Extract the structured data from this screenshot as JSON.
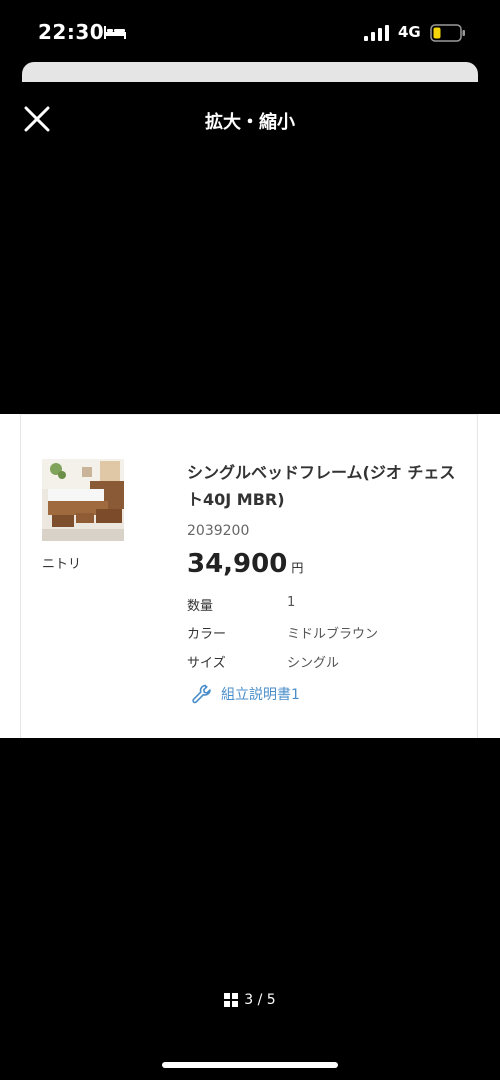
{
  "status_bar": {
    "time": "22:30",
    "network": "4G",
    "battery_color": "#f5d60a"
  },
  "header": {
    "title": "拡大・縮小",
    "close_icon": "close-icon"
  },
  "product": {
    "brand": "ニトリ",
    "name": "シングルベッドフレーム(ジオ チェスト40J MBR)",
    "code": "2039200",
    "price": "34,900",
    "price_unit": "円",
    "specs": [
      {
        "label": "数量",
        "value": "1"
      },
      {
        "label": "カラー",
        "value": "ミドルブラウン"
      },
      {
        "label": "サイズ",
        "value": "シングル"
      }
    ],
    "manual_link": "組立説明書1",
    "manual_icon": "wrench-icon",
    "link_color": "#4a8ec9"
  },
  "pager": {
    "text": "3 / 5",
    "icon": "grid-icon"
  }
}
